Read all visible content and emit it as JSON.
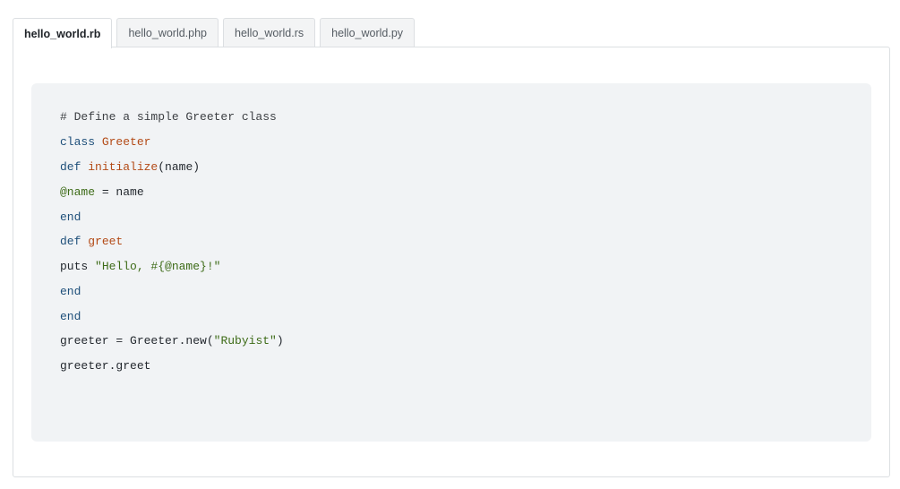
{
  "tabs": [
    {
      "label": "hello_world.rb",
      "active": true
    },
    {
      "label": "hello_world.php",
      "active": false
    },
    {
      "label": "hello_world.rs",
      "active": false
    },
    {
      "label": "hello_world.py",
      "active": false
    }
  ],
  "code": {
    "language": "ruby",
    "lines": [
      {
        "comment": "# Define a simple Greeter class"
      },
      {
        "keyword": "class",
        "space": " ",
        "class_name": "Greeter"
      },
      {
        "keyword": "def",
        "space": " ",
        "func": "initialize",
        "rest": "(name)"
      },
      {
        "ivar": "@name",
        "rest": " = name"
      },
      {
        "keyword": "end"
      },
      {
        "keyword": "def",
        "space": " ",
        "func": "greet"
      },
      {
        "plain": "puts ",
        "string": "\"Hello, #{@name}!\""
      },
      {
        "keyword": "end"
      },
      {
        "keyword": "end"
      },
      {
        "plain": "greeter = Greeter.new(",
        "string": "\"Rubyist\"",
        "rest": ")"
      },
      {
        "plain": "greeter.greet"
      }
    ]
  },
  "colors": {
    "keyword": "#1e4f7a",
    "class_name": "#b34a16",
    "string": "#3d6b17",
    "code_background": "#f1f3f5"
  }
}
